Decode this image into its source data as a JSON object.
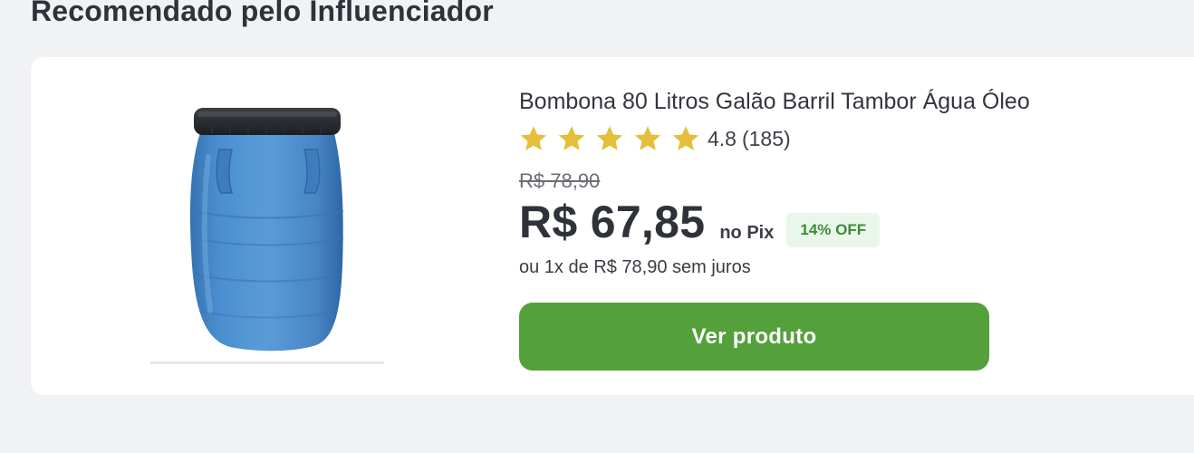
{
  "section": {
    "title": "Recomendado pelo Influenciador"
  },
  "product": {
    "title": "Bombona 80 Litros Galão Barril Tambor Água Óleo",
    "image_icon": "blue-barrel-image",
    "rating": {
      "stars": 5,
      "value": "4.8",
      "count": "(185)",
      "star_color": "#e3bf3a"
    },
    "old_price": "R$ 78,90",
    "price": "R$ 67,85",
    "pix_label": "no Pix",
    "discount": "14% OFF",
    "installments": "ou 1x de R$ 78,90 sem juros",
    "cta_label": "Ver produto"
  },
  "colors": {
    "background": "#f1f2f4",
    "card": "#ffffff",
    "cta": "#54a03a",
    "badge_bg": "#e9f7ea",
    "badge_text": "#3f8a3a",
    "barrel": "#4a8fcd"
  }
}
